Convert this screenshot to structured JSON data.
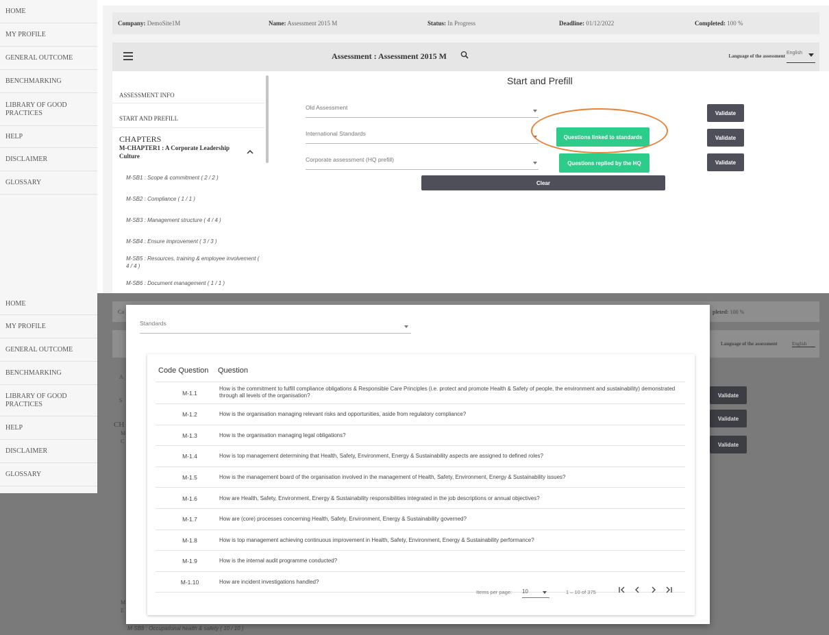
{
  "nav": {
    "items": [
      "HOME",
      "MY PROFILE",
      "GENERAL OUTCOME",
      "BENCHMARKING",
      "LIBRARY OF GOOD PRACTICES",
      "HELP",
      "DISCLAIMER",
      "GLOSSARY"
    ]
  },
  "info_bar": {
    "company_label": "Company:",
    "company_value": "DemoSite1M",
    "name_label": "Name:",
    "name_value": "Assessment 2015 M",
    "status_label": "Status:",
    "status_value": "In Progress",
    "deadline_label": "Deadline:",
    "deadline_value": "01/12/2022",
    "completed_label": "Completed:",
    "completed_value": "100 %"
  },
  "assessment_bar": {
    "title": "Assessment : Assessment 2015 M",
    "language_label": "Language of the assessment",
    "language_value": "English"
  },
  "chapter_panel": {
    "assessment_info": "ASSESSMENT INFO",
    "start_prefill": "START AND PREFILL",
    "chapters_heading": "CHAPTERS",
    "chapter_title": "M-CHAPTER1 : A Corporate Leadership Culture",
    "subchapters": [
      "M-SB1 : Scope & commitment ( 2 / 2 )",
      "M-SB2 : Compliance ( 1 / 1 )",
      "M-SB3 : Management structure ( 4 / 4 )",
      "M-SB4 : Ensure improvement ( 3 / 3 )",
      "M-SB5 : Resources, training & employee involvement ( 4 / 4 )",
      "M-SB6 : Document management ( 1 / 1 )"
    ],
    "last_visible_sub": "M-SB8 : Occupational health & safety ( 10 / 10 )"
  },
  "prefill": {
    "title": "Start and Prefill",
    "old_assessment_placeholder": "Old Assessment",
    "intl_standards_placeholder": "International Standards",
    "corporate_placeholder": "Corporate assessment (HQ prefill)",
    "validate_label": "Validate",
    "questions_standards_label": "Questions linked to standards",
    "questions_hq_label": "Questions replied by the HQ",
    "clear_label": "Clear"
  },
  "dialog": {
    "standards_placeholder": "Standards",
    "col_code": "Code Question",
    "col_question": "Question",
    "rows": [
      {
        "code": "M-1.1",
        "question": "How is the commitment to fulfill compliance obligations & Responsible Care Principles (i.e. protect and promote Health & Safety of people, the environment and sustainability) demonstrated through all levels of the organisation?"
      },
      {
        "code": "M-1.2",
        "question": "How is the organisation managing relevant risks and opportunities, aside from regulatory compliance?"
      },
      {
        "code": "M-1.3",
        "question": "How is the organisation managing legal obligations?"
      },
      {
        "code": "M-1.4",
        "question": "How is top management determining that Health, Safety, Environment, Energy & Sustainability aspects are assigned to defined roles?"
      },
      {
        "code": "M-1.5",
        "question": "How is the management board of the organisation involved in the management of Health, Safety, Environment, Energy & Sustainability issues?"
      },
      {
        "code": "M-1.6",
        "question": "How are Health, Safety, Environment, Energy & Sustainability responsibilities integrated in the job descriptions or annual objectives?"
      },
      {
        "code": "M-1.7",
        "question": "How are (core) processes concerning Health, Safety, Environment, Energy & Sustainability governed?"
      },
      {
        "code": "M-1.8",
        "question": "How is top management achieving continuous improvement in Health, Safety, Environment, Energy & Sustainability performance?"
      },
      {
        "code": "M-1.9",
        "question": "How is the internal audit programme conducted?"
      },
      {
        "code": "M-1.10",
        "question": "How are incident investigations handled?"
      }
    ],
    "paginator": {
      "items_per_page_label": "Items per page:",
      "items_per_page_value": "10",
      "range_label": "1 – 10 of 375"
    }
  },
  "background": {
    "company_fragment": "Co",
    "completed_label": "pleted:",
    "completed_value": "100 %",
    "chapter_fragment_a": "A",
    "chapter_fragment_s": "S",
    "chapters_fragment": "CH",
    "chapter_m": "M",
    "chapter_c": "C",
    "bottom_m": "M",
    "bottom_e": "E"
  },
  "colors": {
    "green": "#2ecc8b",
    "dark_button": "#4f4f5a",
    "highlight": "#e8823a"
  }
}
